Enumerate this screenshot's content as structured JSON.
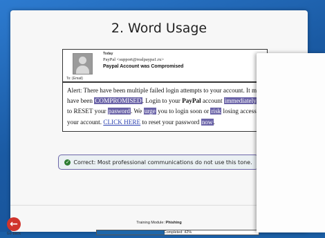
{
  "page": {
    "title": "2. Word Usage"
  },
  "email": {
    "date": "Today",
    "from": "PayPal <support@realpaypa1.ru>",
    "subject": "Paypal Account was Compromised",
    "to": "To: {Email}",
    "body": {
      "p1": "Alert: There have been multiple failed login attempts to your account. It may have been ",
      "w_compromised": "COMPROMISED",
      "p2": ". Login to your ",
      "w_paypal": "PayPal",
      "p3": " account ",
      "w_immediately": "immediately",
      "p4": " to RESET your ",
      "w_password": "pasword",
      "p5": ". We ",
      "w_urge": "urge",
      "p6": " you to login soon or ",
      "w_risk": "risk",
      "p7": " losing access to your account. ",
      "link": "CLICK HERE",
      "p8": " to reset your password ",
      "w_now": "now",
      "p9": "."
    }
  },
  "feedback": {
    "text": "Correct: Most professional communications do not use this tone."
  },
  "footer": {
    "back_label": "Go back",
    "module_label": "Training Module: ",
    "module_name": "Phishing",
    "progress_text": "Completed: 42%",
    "progress_value": 0.42
  },
  "colors": {
    "highlight": "#6b64a8",
    "back": "#d0342c",
    "progress": "#1f66a8"
  }
}
